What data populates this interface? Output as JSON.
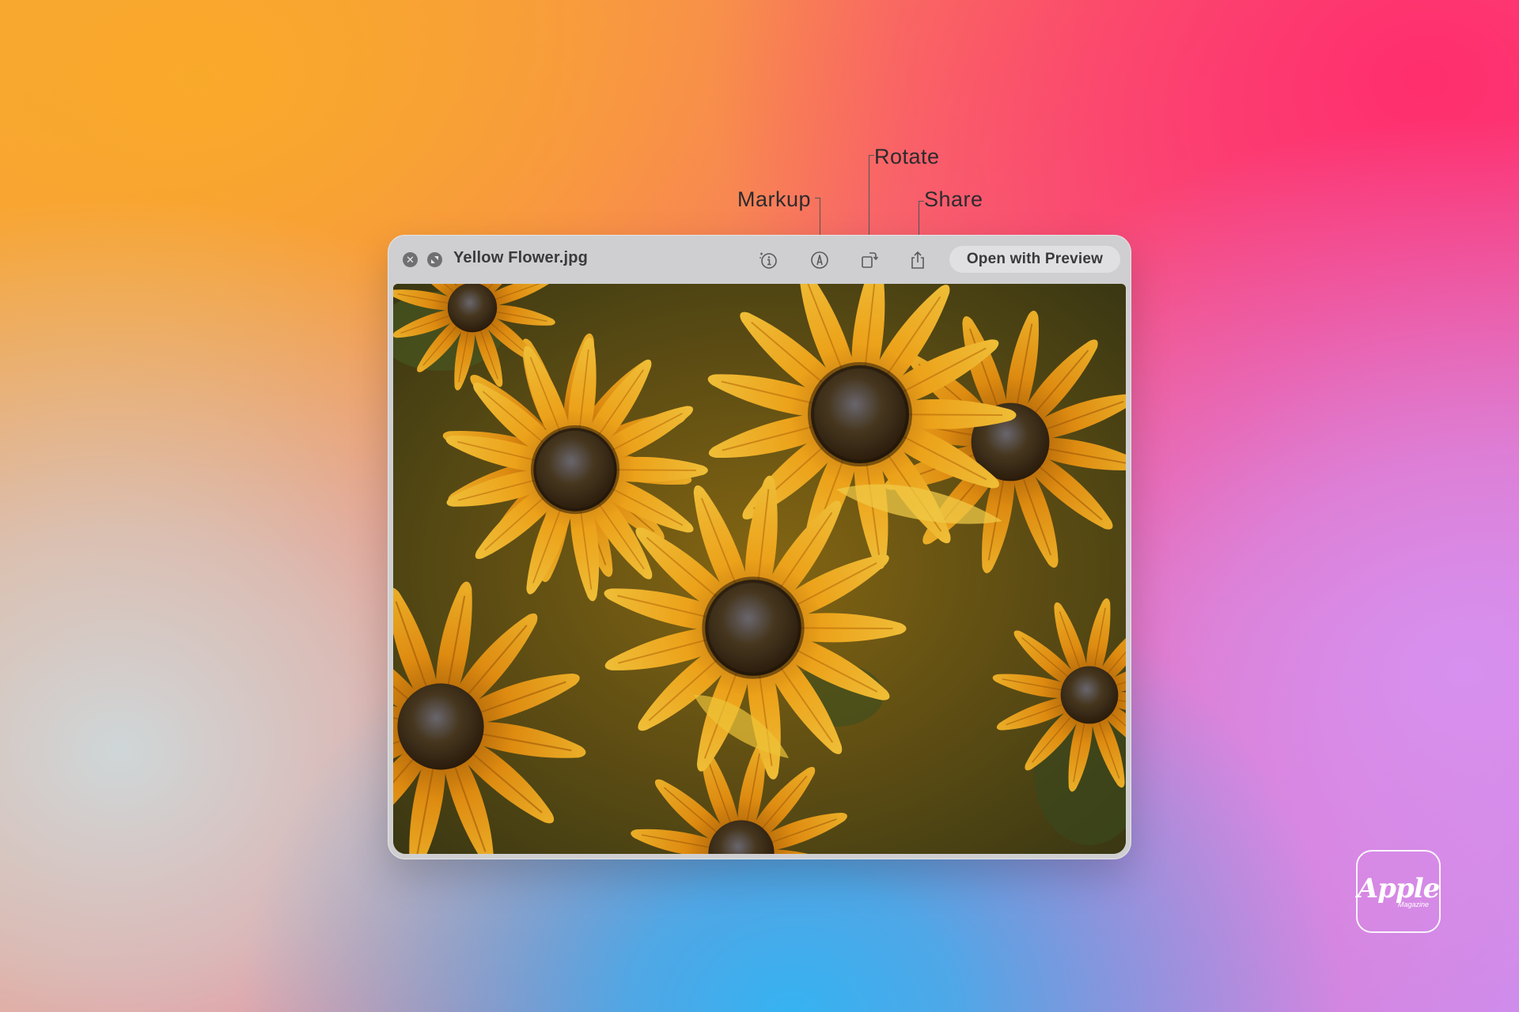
{
  "window": {
    "file_name": "Yellow Flower.jpg",
    "close_icon": "close-icon",
    "fullscreen_icon": "fullscreen-icon",
    "open_button_label": "Open with Preview"
  },
  "toolbar": {
    "info_icon": "live-text-info-icon",
    "markup_icon": "markup-pen-icon",
    "rotate_icon": "rotate-icon",
    "share_icon": "share-icon"
  },
  "callouts": {
    "markup": "Markup",
    "rotate": "Rotate",
    "share": "Share"
  },
  "photo": {
    "subject": "yellow flowers"
  },
  "logo": {
    "brand": "Apple",
    "sub": "Magazine"
  },
  "colors": {
    "window_bg": "#cfcfd1",
    "button_bg": "#e0e0e2",
    "text": "#3a3a3c",
    "petal": "#f2a51a",
    "flower_center": "#3b2a14"
  }
}
